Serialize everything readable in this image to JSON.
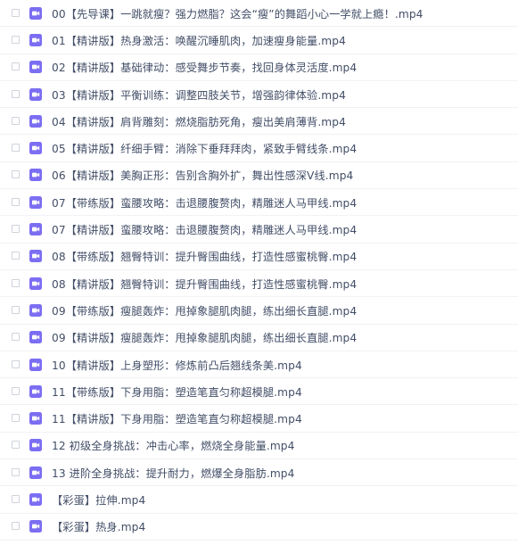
{
  "colors": {
    "text": "#424e67",
    "icon": "#7c6ef2",
    "row_divider": "#f1f2f6",
    "checkbox_border": "#cfd3dc"
  },
  "icons": {
    "file_type": "video-file-icon",
    "selector": "checkbox"
  },
  "files": [
    {
      "name": "00【先导课】一跳就瘦？强力燃脂？这会“瘦”的舞蹈小心一学就上瘾！.mp4"
    },
    {
      "name": "01【精讲版】热身激活：唤醒沉睡肌肉，加速瘦身能量.mp4"
    },
    {
      "name": "02【精讲版】基础律动：感受舞步节奏，找回身体灵活度.mp4"
    },
    {
      "name": "03【精讲版】平衡训练：调整四肢关节，增强韵律体验.mp4"
    },
    {
      "name": "04【精讲版】肩背雕刻：燃烧脂肪死角，瘦出美肩薄背.mp4"
    },
    {
      "name": "05【精讲版】纤细手臂：消除下垂拜拜肉，紧致手臂线条.mp4"
    },
    {
      "name": "06【精讲版】美胸正形：告别含胸外扩，舞出性感深V线.mp4"
    },
    {
      "name": "07【带练版】蛮腰攻略：击退腰腹赘肉，精雕迷人马甲线.mp4"
    },
    {
      "name": "07【精讲版】蛮腰攻略：击退腰腹赘肉，精雕迷人马甲线.mp4"
    },
    {
      "name": "08【带练版】翘臀特训：提升臀围曲线，打造性感蜜桃臀.mp4"
    },
    {
      "name": "08【精讲版】翘臀特训：提升臀围曲线，打造性感蜜桃臀.mp4"
    },
    {
      "name": "09【带练版】瘦腿轰炸：甩掉象腿肌肉腿，练出细长直腿.mp4"
    },
    {
      "name": "09【精讲版】瘦腿轰炸：甩掉象腿肌肉腿，练出细长直腿.mp4"
    },
    {
      "name": "10【精讲版】上身塑形：修炼前凸后翘线条美.mp4"
    },
    {
      "name": "11【带练版】下身用脂：塑造笔直匀称超模腿.mp4"
    },
    {
      "name": "11【精讲版】下身用脂：塑造笔直匀称超模腿.mp4"
    },
    {
      "name": "12 初级全身挑战：冲击心率，燃烧全身能量.mp4"
    },
    {
      "name": "13 进阶全身挑战：提升耐力，燃爆全身脂肪.mp4"
    },
    {
      "name": "【彩蛋】拉伸.mp4"
    },
    {
      "name": "【彩蛋】热身.mp4"
    }
  ]
}
